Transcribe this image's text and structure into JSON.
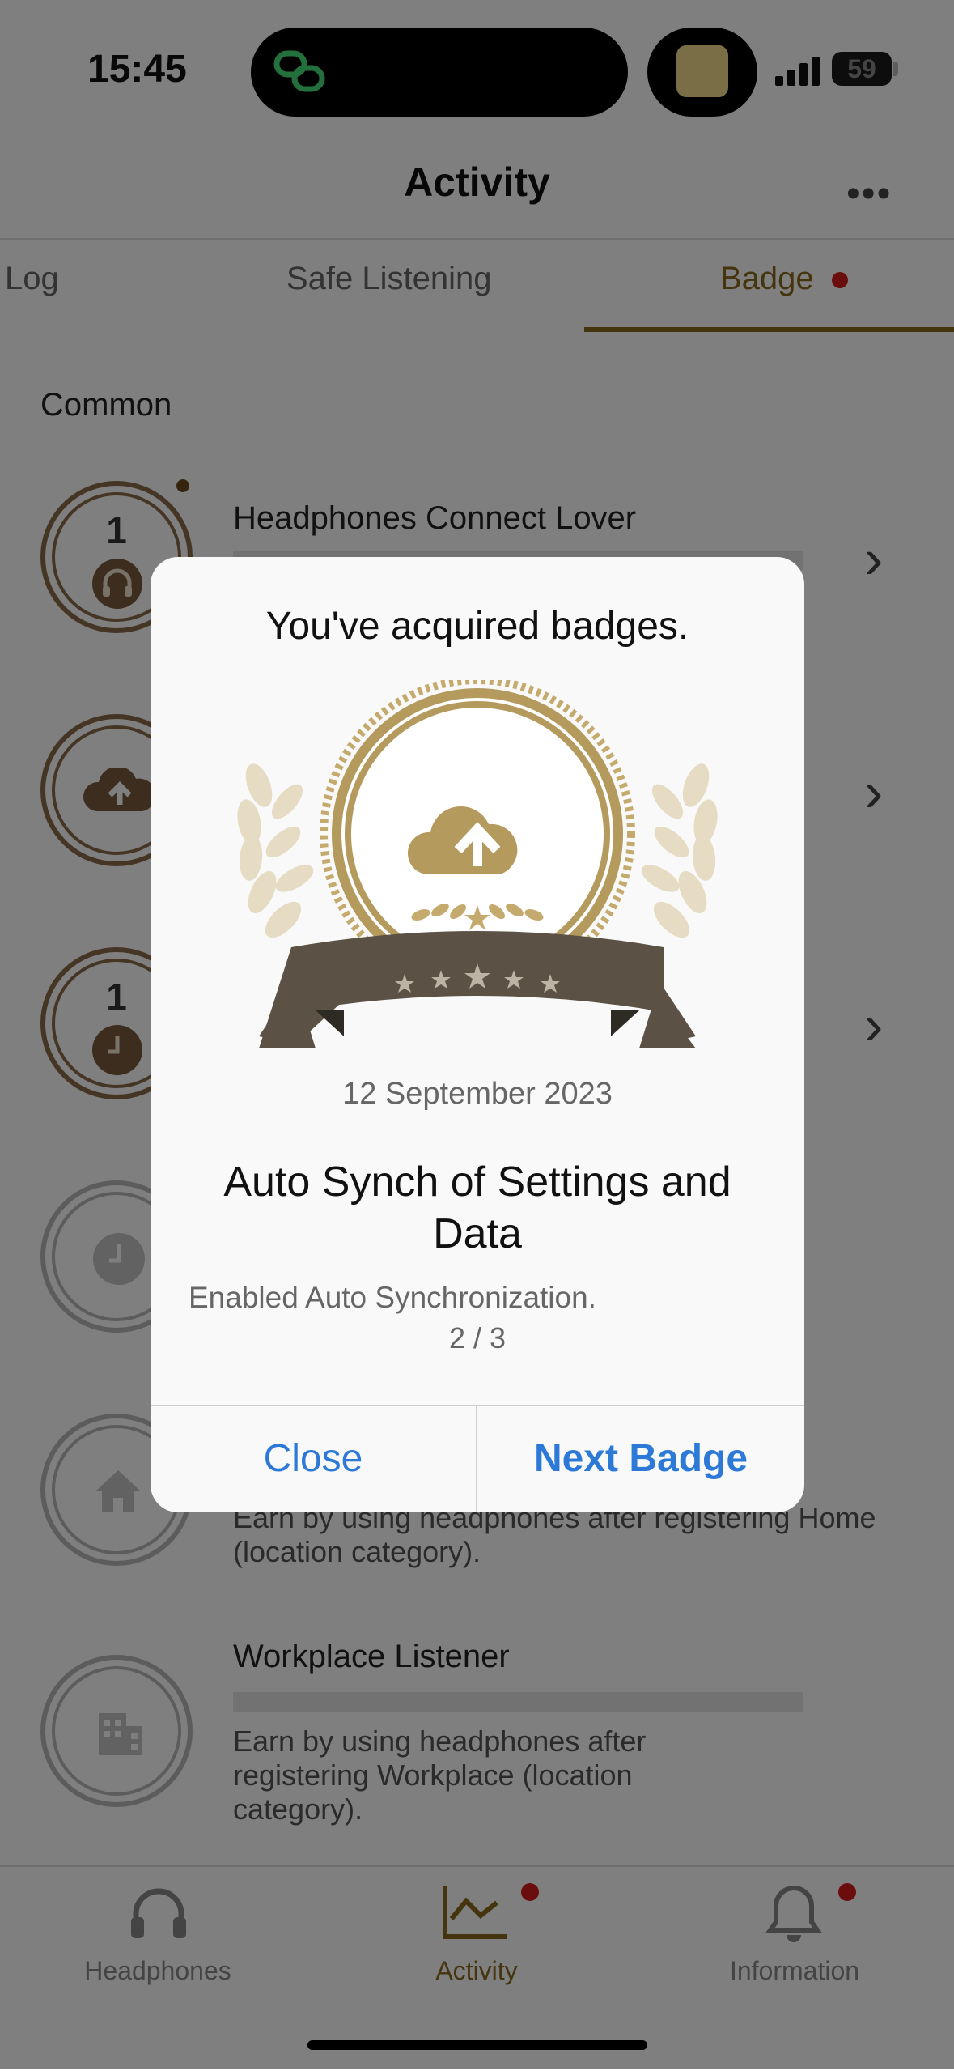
{
  "status_bar": {
    "time": "15:45",
    "battery": "59"
  },
  "header": {
    "title": "Activity",
    "more": "•••"
  },
  "tabs": [
    {
      "label": "Log"
    },
    {
      "label": "Safe Listening"
    },
    {
      "label": "Badge"
    }
  ],
  "section": {
    "title": "Common"
  },
  "badges": [
    {
      "count": "1",
      "title": "Headphones Connect Lover",
      "icon": "headphones-icon"
    },
    {
      "icon": "cloud-upload-icon"
    },
    {
      "count": "1",
      "icon": "clock-icon"
    },
    {
      "icon": "clock-icon"
    },
    {
      "icon": "home-icon",
      "desc": "Earn by using headphones after registering Home (location category)."
    },
    {
      "icon": "building-icon",
      "title": "Workplace Listener",
      "desc": "Earn by using headphones after registering Workplace (location category)."
    }
  ],
  "tab_bar": [
    {
      "label": "Headphones",
      "icon": "headphones-icon"
    },
    {
      "label": "Activity",
      "icon": "activity-chart-icon"
    },
    {
      "label": "Information",
      "icon": "bell-icon"
    }
  ],
  "modal": {
    "title": "You've acquired badges.",
    "date": "12 September 2023",
    "badge_name": "Auto Synch of Settings and Data",
    "description": "Enabled Auto Synchronization.",
    "page": "2 / 3",
    "close_label": "Close",
    "next_label": "Next Badge"
  },
  "colors": {
    "accent_gold": "#8a6a1c",
    "badge_brown": "#8a6a4a",
    "link_blue": "#2c79d8",
    "notification_red": "#d21b1b"
  }
}
